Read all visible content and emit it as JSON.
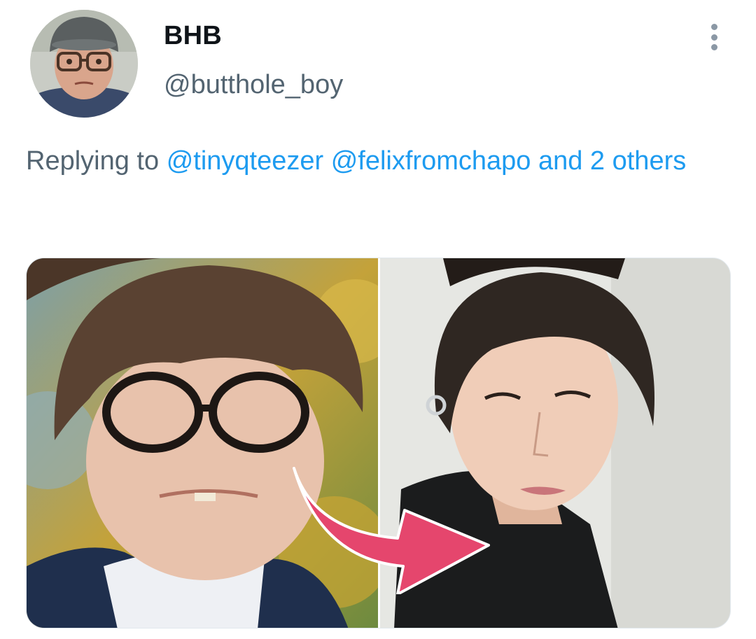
{
  "tweet": {
    "author": {
      "display_name": "BHB",
      "handle": "@butthole_boy",
      "avatar_icon": "avatar-photo"
    },
    "more_icon": "more-vertical-icon",
    "reply": {
      "prefix": "Replying to",
      "mention_1": "@tinyqteezer",
      "mention_2": "@felixfromchapo",
      "suffix": "and 2 others"
    },
    "media": {
      "left_photo": "person-with-glasses-photo",
      "right_photo": "person-dark-hair-photo",
      "arrow_icon": "pink-arrow-icon"
    }
  },
  "colors": {
    "text_primary": "#0f1419",
    "text_secondary": "#536471",
    "link": "#1d9bf0",
    "arrow": "#e5466d"
  }
}
